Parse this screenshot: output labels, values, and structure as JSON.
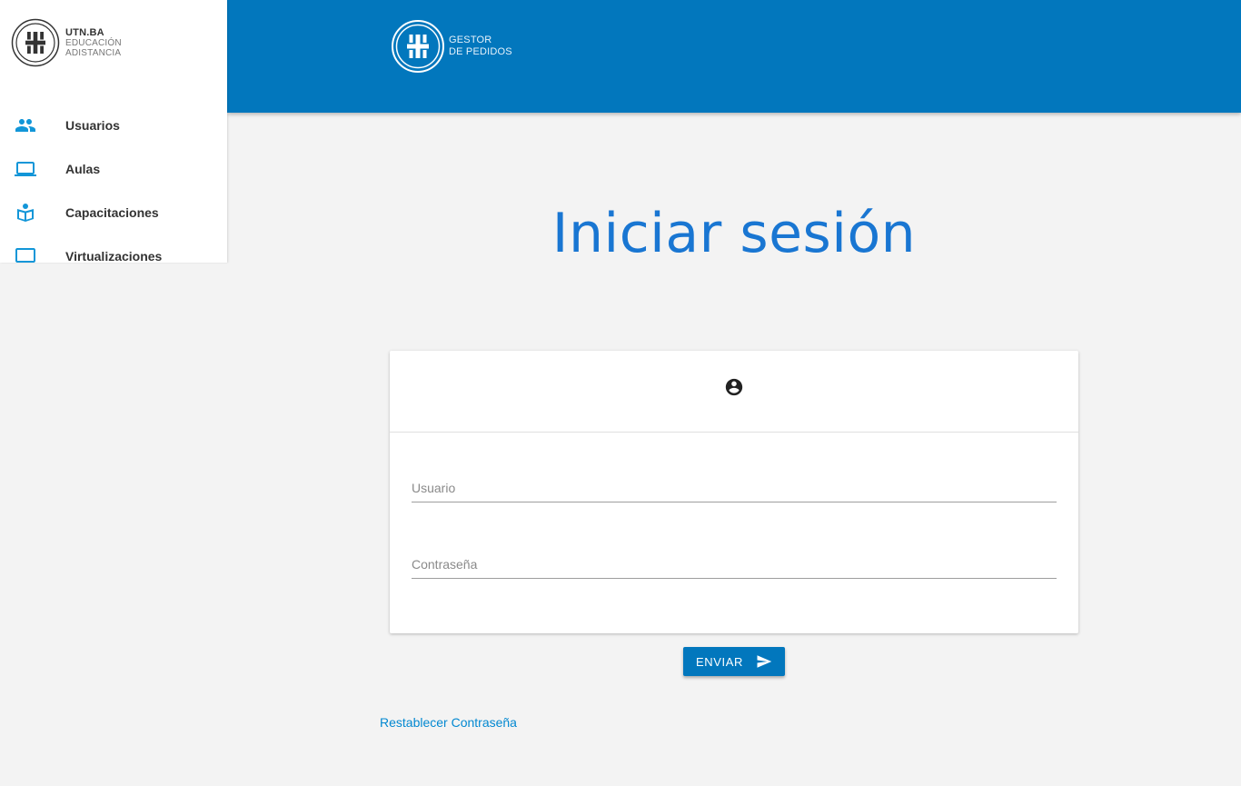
{
  "header": {
    "logo_line1": "GESTOR",
    "logo_line2": "DE PEDIDOS"
  },
  "sidebar": {
    "brand_line1": "UTN.BA",
    "brand_line2": "EDUCACIÓN",
    "brand_line3": "ADISTANCIA",
    "items": [
      {
        "label": "Usuarios",
        "icon": "people-icon"
      },
      {
        "label": "Aulas",
        "icon": "laptop-icon"
      },
      {
        "label": "Capacitaciones",
        "icon": "book-reader-icon"
      },
      {
        "label": "Virtualizaciones",
        "icon": "monitor-icon"
      }
    ]
  },
  "main": {
    "title": "Iniciar sesión",
    "login_card": {
      "avatar_icon": "account-circle-icon",
      "username_placeholder": "Usuario",
      "password_placeholder": "Contraseña"
    },
    "submit_label": "ENVIAR",
    "submit_icon": "send-icon",
    "reset_link": "Restablecer Contraseña"
  },
  "colors": {
    "primary": "#0277bd",
    "title": "#1976d2",
    "link": "#0288d1",
    "icon": "#1296d8",
    "background": "#f3f3f3"
  }
}
